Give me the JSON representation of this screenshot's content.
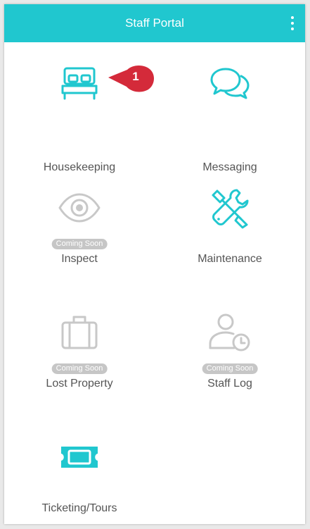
{
  "header": {
    "title": "Staff Portal",
    "menu_icon": "vertical-dots-icon"
  },
  "colors": {
    "accent": "#20c7cf",
    "disabled": "#c8c8c8",
    "badge": "#c6c6c6",
    "callout": "#d42a3a"
  },
  "tiles": [
    {
      "label": "Housekeeping",
      "icon": "bed-icon",
      "badge": ""
    },
    {
      "label": "Messaging",
      "icon": "chat-bubbles-icon",
      "badge": ""
    },
    {
      "label": "Inspect",
      "icon": "eye-icon",
      "badge": "Coming Soon"
    },
    {
      "label": "Maintenance",
      "icon": "tools-icon",
      "badge": ""
    },
    {
      "label": "Lost Property",
      "icon": "suitcase-icon",
      "badge": "Coming Soon"
    },
    {
      "label": "Staff Log",
      "icon": "user-clock-icon",
      "badge": "Coming Soon"
    },
    {
      "label": "Ticketing/Tours",
      "icon": "ticket-icon",
      "badge": ""
    }
  ],
  "callout": {
    "number": "1"
  }
}
